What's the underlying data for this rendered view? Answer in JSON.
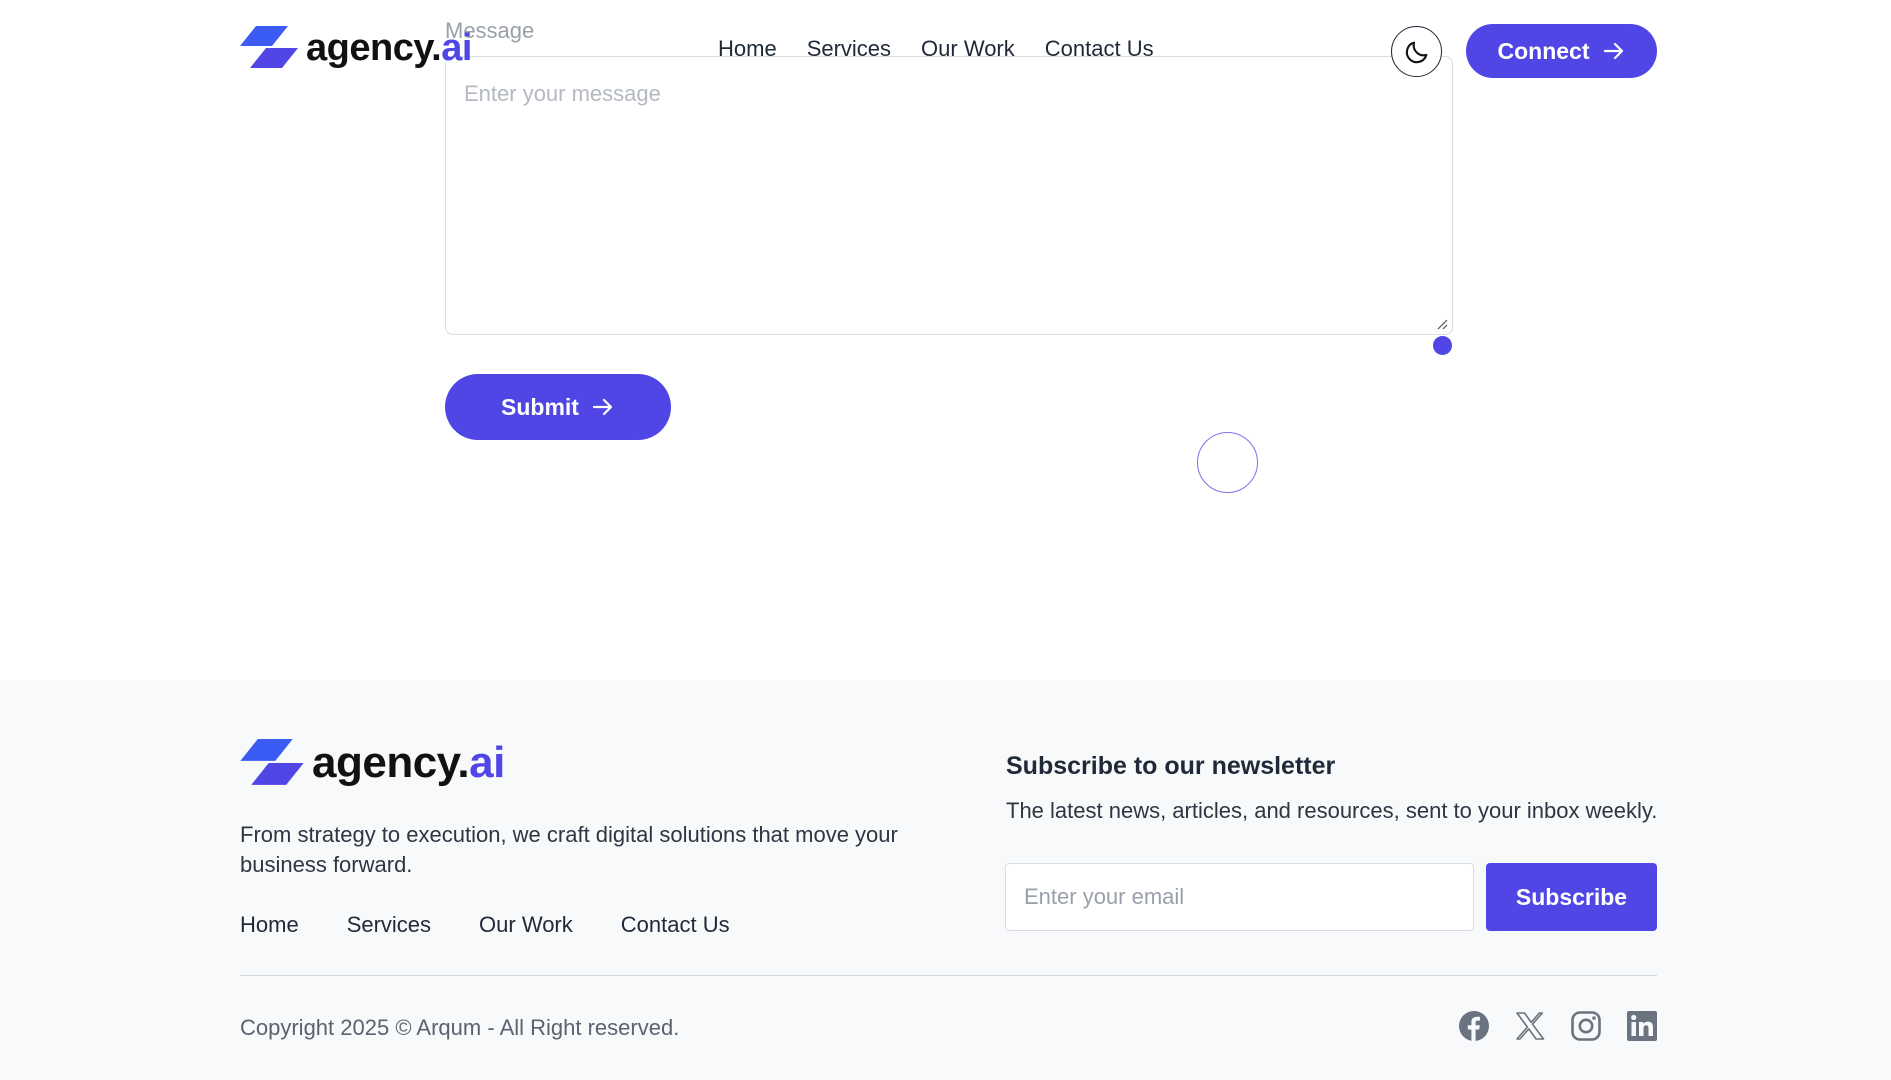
{
  "header": {
    "logo": {
      "brand": "agency.",
      "suffix": "ai"
    },
    "nav": [
      "Home",
      "Services",
      "Our Work",
      "Contact Us"
    ],
    "theme_toggle_icon": "moon-icon",
    "connect_label": "Connect"
  },
  "form": {
    "message_label": "Message",
    "message_placeholder": "Enter your message",
    "submit_label": "Submit"
  },
  "footer": {
    "logo": {
      "brand": "agency.",
      "suffix": "ai"
    },
    "tagline": "From strategy to execution, we craft digital solutions that move your business forward.",
    "nav": [
      "Home",
      "Services",
      "Our Work",
      "Contact Us"
    ],
    "newsletter": {
      "title": "Subscribe to our newsletter",
      "description": "The latest news, articles, and resources, sent to your inbox weekly.",
      "email_placeholder": "Enter your email",
      "subscribe_label": "Subscribe"
    },
    "copyright": "Copyright 2025 © Arqum - All Right reserved.",
    "social_icons": [
      "facebook-icon",
      "x-icon",
      "instagram-icon",
      "linkedin-icon"
    ]
  },
  "colors": {
    "accent": "#4f46e5",
    "footer_bg": "#f8f9fb",
    "text": "#1f2937"
  }
}
